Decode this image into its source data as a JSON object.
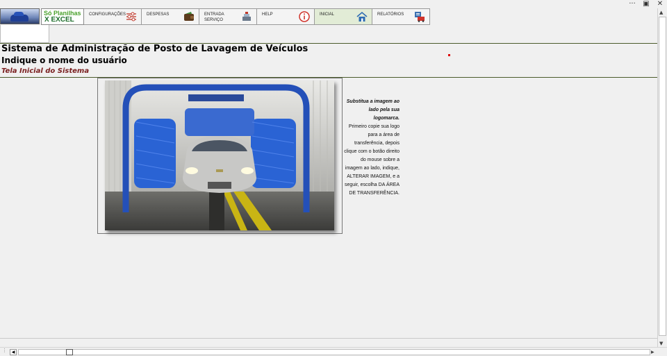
{
  "window": {
    "controls": [
      "···",
      "▣",
      "✕"
    ]
  },
  "brand": {
    "line1": "Só Planilhas",
    "line2": "X EXCEL"
  },
  "nav": [
    {
      "label": "CONFIGURAÇÕES",
      "icon": "sliders-icon"
    },
    {
      "label": "DESPESAS",
      "icon": "wallet-icon"
    },
    {
      "label": "ENTRADA\nSERVIÇO",
      "icon": "cash-register-icon"
    },
    {
      "label": "HELP",
      "icon": "info-icon"
    },
    {
      "label": "INICIAL",
      "icon": "home-icon"
    },
    {
      "label": "RELATÓRIOS",
      "icon": "report-icon"
    }
  ],
  "header": {
    "title": "Sistema de Administração de Posto de Lavagem de Veículos",
    "user": "Indique o nome do usuário",
    "subtitle": "Tela Inicial do Sistema"
  },
  "note": {
    "bold": "Substitua a imagem ao lado pela sua logomarca.",
    "text": "Primeiro copie sua logo para a área de transferência, depois clique com o botão direito do mouse sobre a imagem ao lado, indique, ALTERAR IMAGEM, e a seguir, escolha DA ÁREA DE TRANSFERÊNCIA."
  },
  "colors": {
    "accent_rule": "#4a5a2a",
    "subtitle": "#7a2020",
    "active_tab": "#e2ecd6"
  }
}
